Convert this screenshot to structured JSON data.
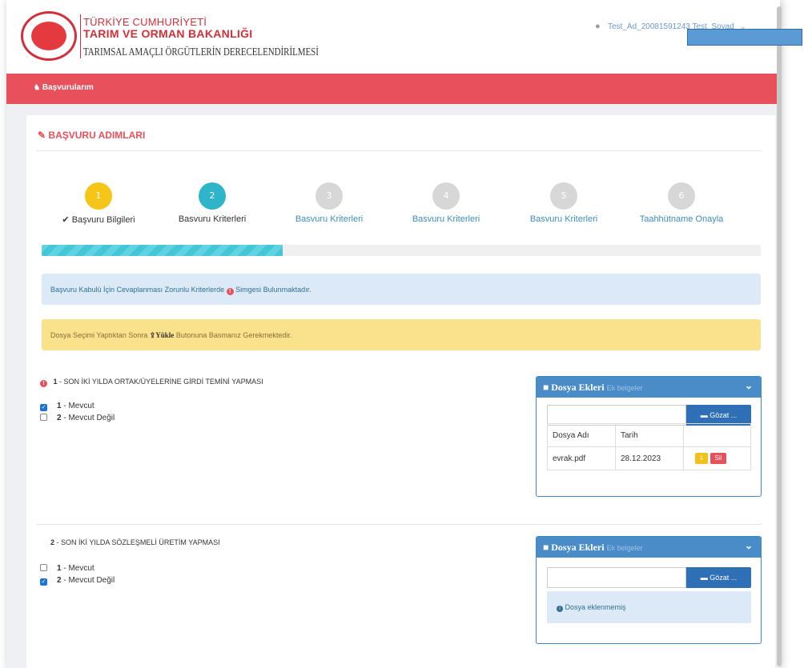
{
  "header": {
    "org_line1": "TÜRKİYE CUMHURİYETİ",
    "org_line2": "TARIM VE ORMAN BAKANLIĞI",
    "org_line3": "TARIMSAL AMAÇLI ÖRGÜTLERİN DERECELENDİRİLMESİ",
    "user": "Test_Ad_20081591243 Test_Soyad"
  },
  "nav": {
    "item": "Başvurularım"
  },
  "panel": {
    "title": "BAŞVURU ADIMLARI"
  },
  "steps": [
    {
      "num": "1",
      "label": "✔ Başvuru Bilgileri",
      "color": "#f5c518",
      "label_color": "#333333"
    },
    {
      "num": "2",
      "label": "Basvuru Kriterleri",
      "color": "#2fb5c9",
      "label_color": "#333333"
    },
    {
      "num": "3",
      "label": "Basvuru Kriterleri",
      "color": "#d7d7d7",
      "label_color": "#3c8dbc"
    },
    {
      "num": "4",
      "label": "Basvuru Kriterleri",
      "color": "#d7d7d7",
      "label_color": "#3c8dbc"
    },
    {
      "num": "5",
      "label": "Basvuru Kriterleri",
      "color": "#d7d7d7",
      "label_color": "#3c8dbc"
    },
    {
      "num": "6",
      "label": "Taahhütname Onayla",
      "color": "#d7d7d7",
      "label_color": "#3c8dbc"
    }
  ],
  "progress": {
    "percent": 33.5
  },
  "alerts": {
    "info_pre": "Başvuru Kabulü İçin Cevaplanması Zorunlu Kriterlerde",
    "info_post": "Simgesi Bulunmaktadır.",
    "warn_pre": "Dosya Seçimi Yaptıktan Sonra",
    "warn_btn": "Yükle",
    "warn_post": "Butonuna Basmanız Gerekmektedir."
  },
  "questions": [
    {
      "num": "1",
      "text": "SON İKİ YILDA ORTAK/ÜYELERİNE GİRDİ TEMİNİ YAPMASI",
      "options": [
        {
          "num": "1",
          "label": "Mevcut",
          "checked": true
        },
        {
          "num": "2",
          "label": "Mevcut Değil",
          "checked": false
        }
      ]
    },
    {
      "num": "2",
      "text": "SON İKİ YILDA SÖZLEŞMELİ ÜRETİM YAPMASI",
      "options": [
        {
          "num": "1",
          "label": "Mevcut",
          "checked": false
        },
        {
          "num": "2",
          "label": "Mevcut Değil",
          "checked": true
        }
      ]
    }
  ],
  "dosya": {
    "title": "Dosya Ekleri",
    "subtitle": "Ek belgeler",
    "browse": "Gözat ...",
    "col_name": "Dosya Adı",
    "col_date": "Tarih",
    "file_name": "evrak.pdf",
    "file_date": "28.12.2023",
    "delete": "Sil",
    "empty": "Dosya eklenmemiş"
  }
}
